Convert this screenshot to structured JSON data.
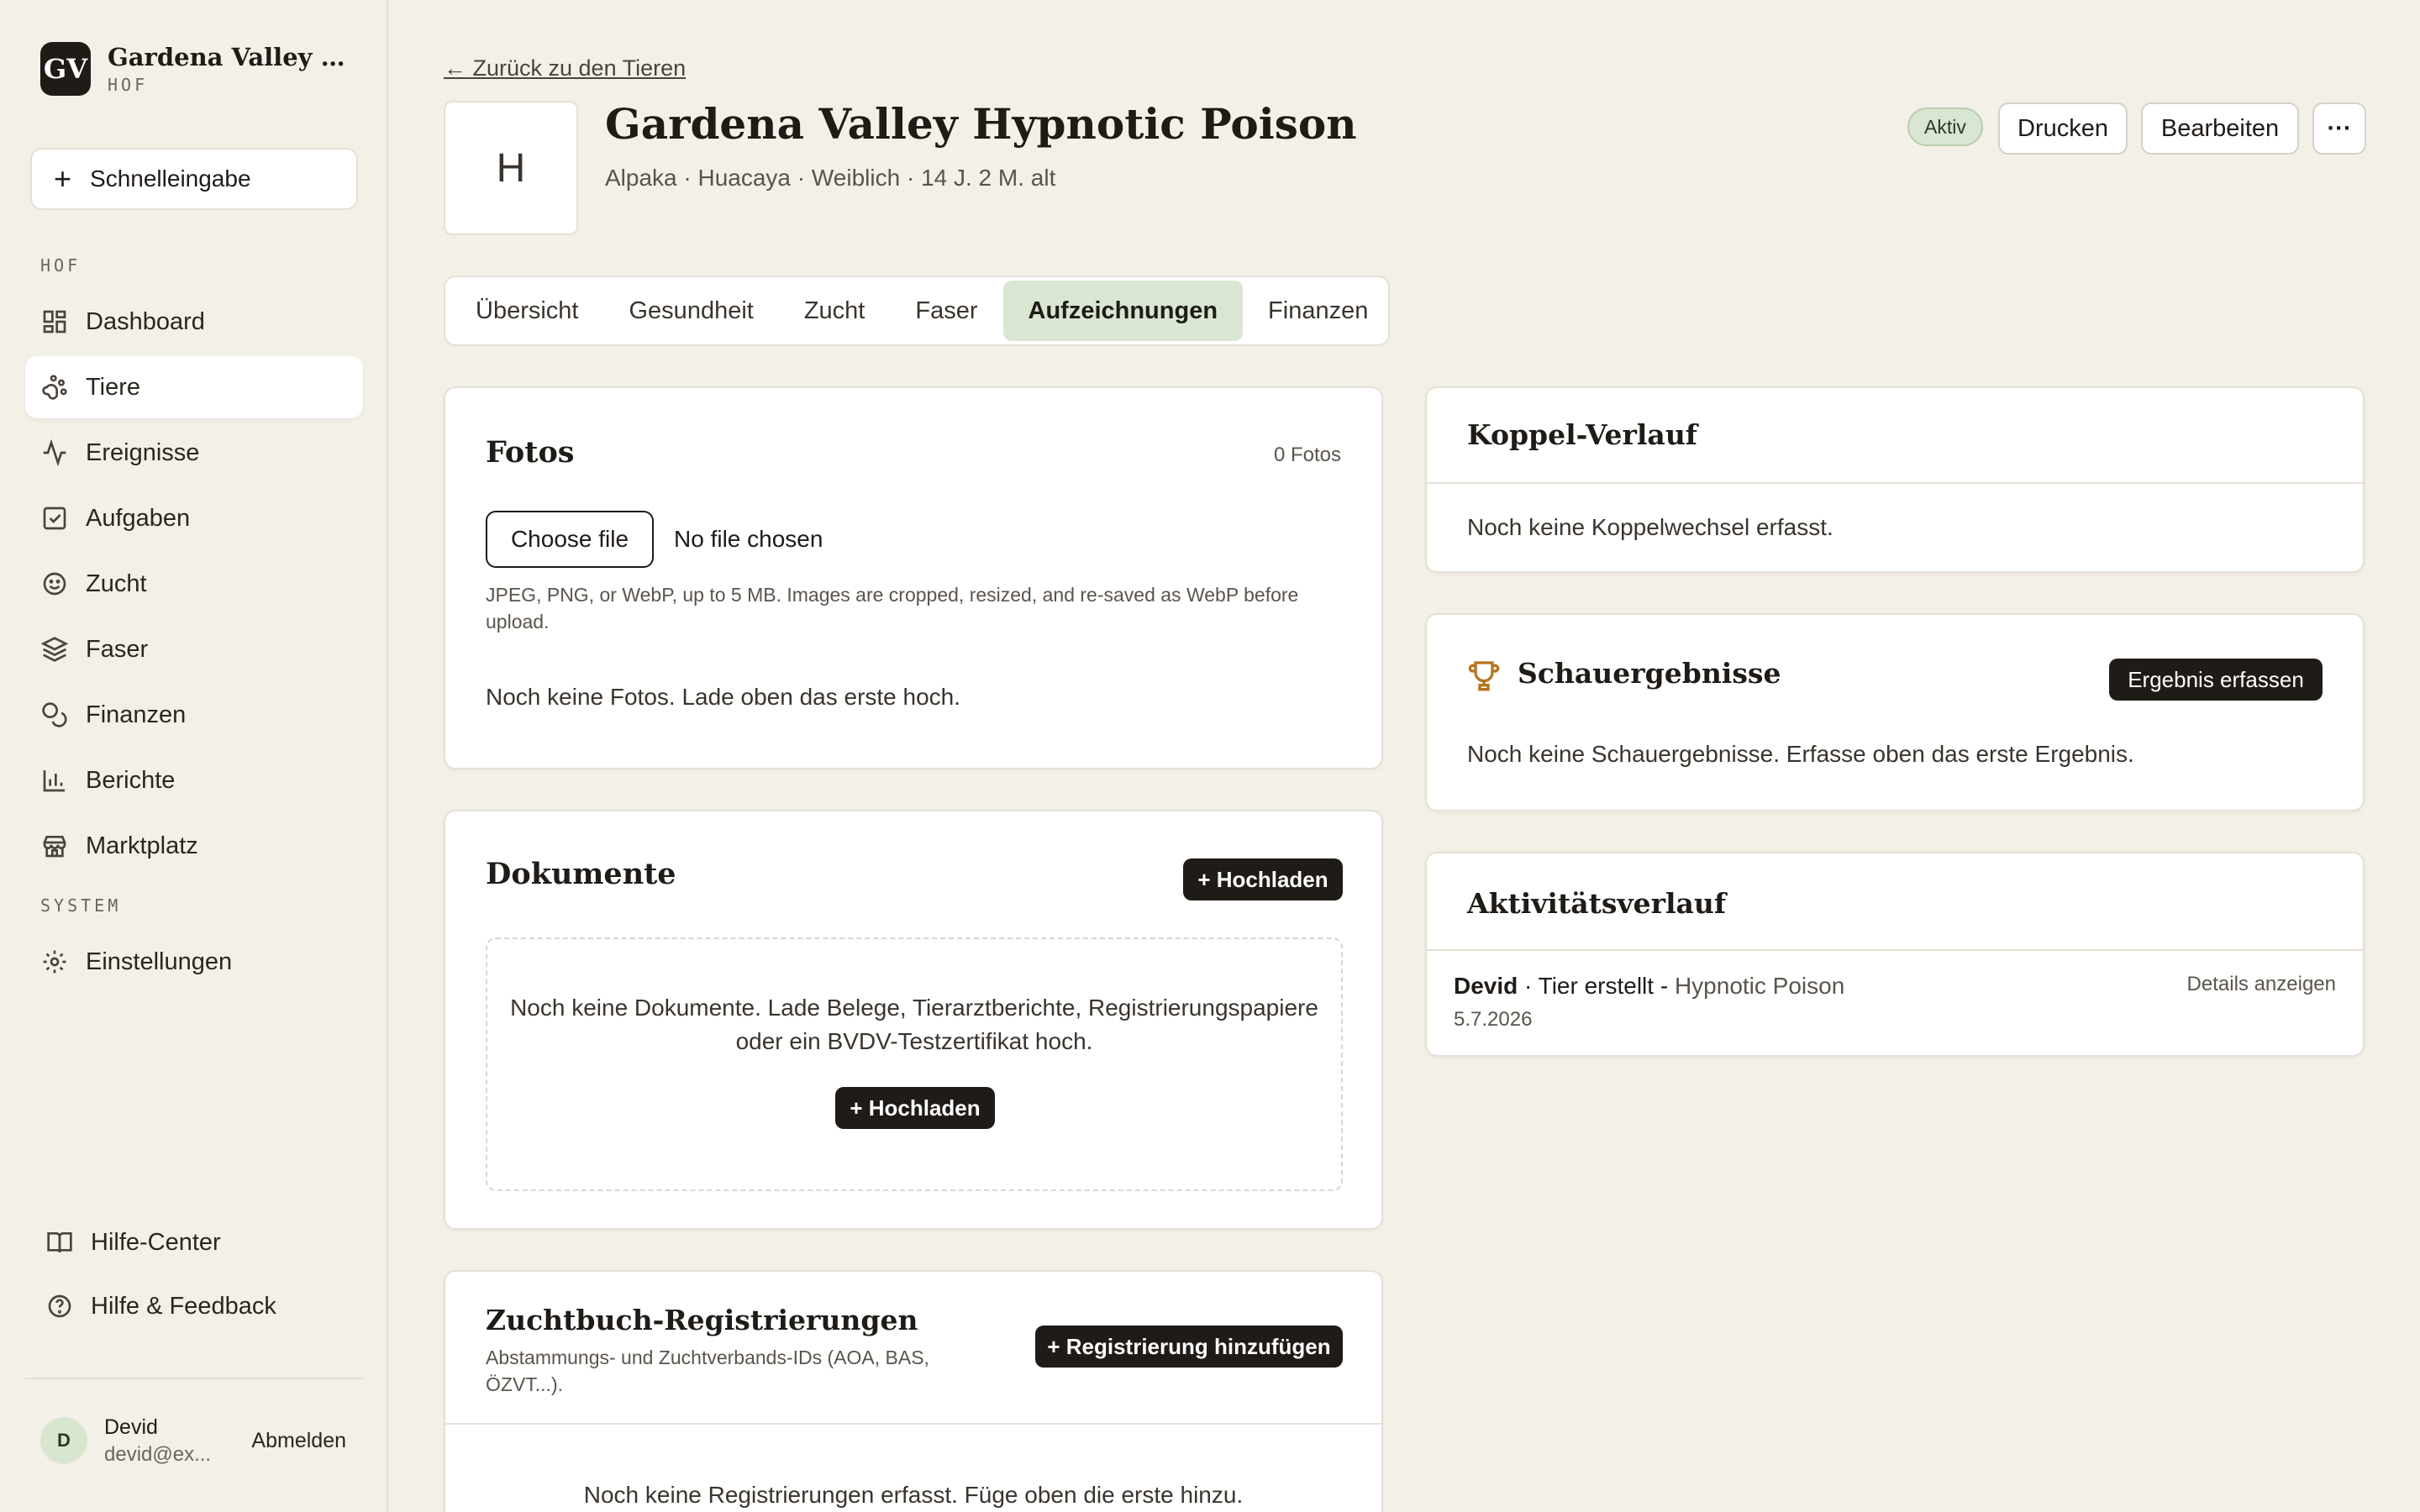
{
  "brand": {
    "logo": "GV",
    "name": "Gardena Valley Alp...",
    "sub": "HOF"
  },
  "quick_entry": {
    "label": "Schnelleingabe"
  },
  "nav": {
    "section_hof": "HOF",
    "section_system": "SYSTEM",
    "items": [
      {
        "label": "Dashboard",
        "icon": "grid-icon"
      },
      {
        "label": "Tiere",
        "icon": "paw-icon"
      },
      {
        "label": "Ereignisse",
        "icon": "activity-icon"
      },
      {
        "label": "Aufgaben",
        "icon": "checkbox-icon"
      },
      {
        "label": "Zucht",
        "icon": "smile-icon"
      },
      {
        "label": "Faser",
        "icon": "layers-icon"
      },
      {
        "label": "Finanzen",
        "icon": "coins-icon"
      },
      {
        "label": "Berichte",
        "icon": "bar-chart-icon"
      },
      {
        "label": "Marktplatz",
        "icon": "store-icon"
      }
    ],
    "settings": "Einstellungen",
    "help_center": "Hilfe-Center",
    "help_feedback": "Hilfe & Feedback"
  },
  "user": {
    "initial": "D",
    "name": "Devid",
    "email": "devid@ex...",
    "logout": "Abmelden"
  },
  "header": {
    "back": "← Zurück zu den Tieren",
    "avatar_letter": "H",
    "title": "Gardena Valley Hypnotic Poison",
    "subtitle": "Alpaka · Huacaya · Weiblich · 14 J. 2 M. alt",
    "status": "Aktiv",
    "print": "Drucken",
    "edit": "Bearbeiten",
    "more": "···"
  },
  "tabs": [
    "Übersicht",
    "Gesundheit",
    "Zucht",
    "Faser",
    "Aufzeichnungen",
    "Finanzen"
  ],
  "photos": {
    "title": "Fotos",
    "count": "0 Fotos",
    "choose": "Choose file",
    "none_chosen": "No file chosen",
    "hint": "JPEG, PNG, or WebP, up to 5 MB. Images are cropped, resized, and re-saved as WebP before upload.",
    "empty": "Noch keine Fotos. Lade oben das erste hoch."
  },
  "documents": {
    "title": "Dokumente",
    "upload": "+ Hochladen",
    "empty": "Noch keine Dokumente. Lade Belege, Tierarztberichte, Registrierungspapiere oder ein BVDV-Testzertifikat hoch.",
    "upload_inner": "+ Hochladen"
  },
  "registrations": {
    "title": "Zuchtbuch-Registrierungen",
    "desc": "Abstammungs- und Zuchtverbands-IDs (AOA, BAS, ÖZVT...).",
    "add": "+ Registrierung hinzufügen",
    "empty": "Noch keine Registrierungen erfasst. Füge oben die erste hinzu."
  },
  "paddock": {
    "title": "Koppel-Verlauf",
    "empty": "Noch keine Koppelwechsel erfasst."
  },
  "shows": {
    "title": "Schauergebnisse",
    "add": "Ergebnis erfassen",
    "empty": "Noch keine Schauergebnisse. Erfasse oben das erste Ergebnis.",
    "icon": "trophy-icon",
    "icon_color": "#b8741a"
  },
  "activity": {
    "title": "Aktivitätsverlauf",
    "entry_user": "Devid",
    "entry_action": " · Tier erstellt - ",
    "entry_target": "Hypnotic Poison",
    "entry_date": "5.7.2026",
    "details": "Details anzeigen"
  }
}
